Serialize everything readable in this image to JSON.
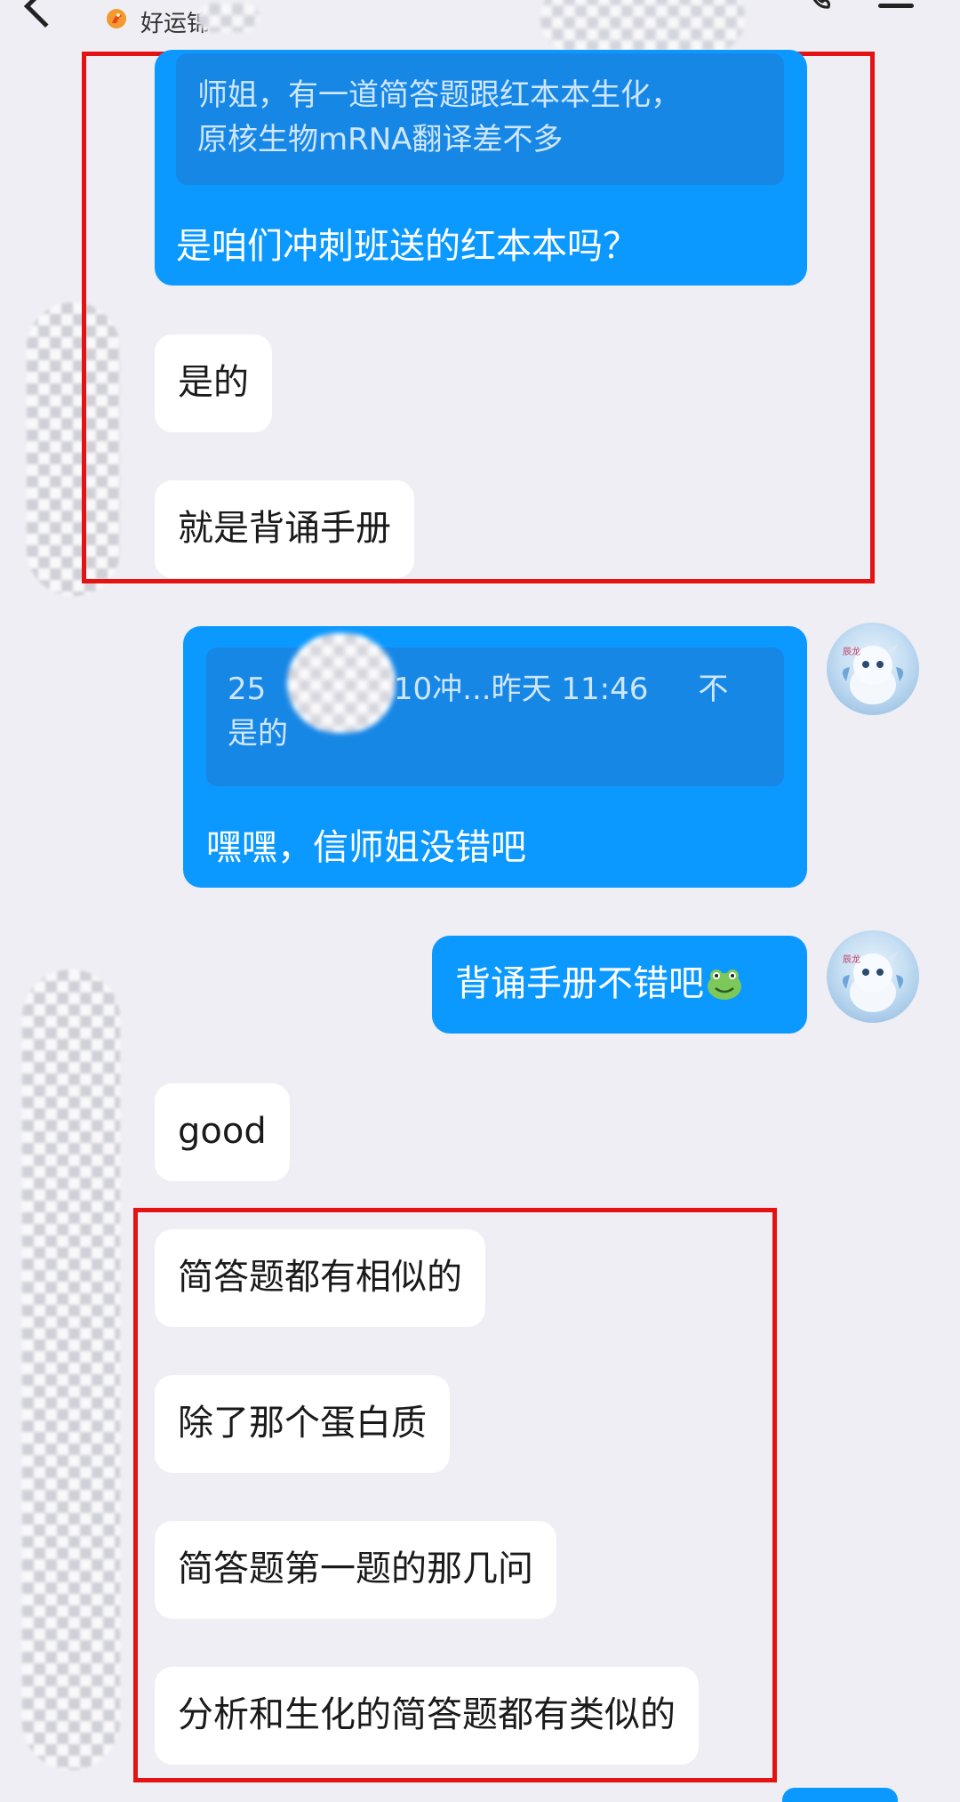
{
  "header": {
    "group_name": "好运锦",
    "back_icon": "back-arrow-icon",
    "call_icon": "phone-icon",
    "menu_icon": "menu-icon"
  },
  "messages": {
    "quote_top": {
      "line1": "师姐，有一道简答题跟红本本生化，",
      "line2": "原核生物mRNA翻译差不多"
    },
    "reply_top": "是咱们冲刺班送的红本本吗？",
    "m1": "是的",
    "m2": "就是背诵手册",
    "quote_mid": {
      "prefix": "25",
      "suffix": "710冲...昨天 11:46",
      "tail": "不",
      "line2": "是的"
    },
    "reply_mid": "嘿嘿，信师姐没错吧",
    "self2": "背诵手册不错吧",
    "m3": "good",
    "m4": "简答题都有相似的",
    "m5": "除了那个蛋白质",
    "m6": "简答题第一题的那几问",
    "m7": "分析和生化的简答题都有类似的"
  },
  "self_avatar_label": "辰龙",
  "colors": {
    "self_bubble": "#0b99ff",
    "quote_bg": "#1787e6",
    "highlight": "#e41212",
    "background": "#eeeef4"
  }
}
